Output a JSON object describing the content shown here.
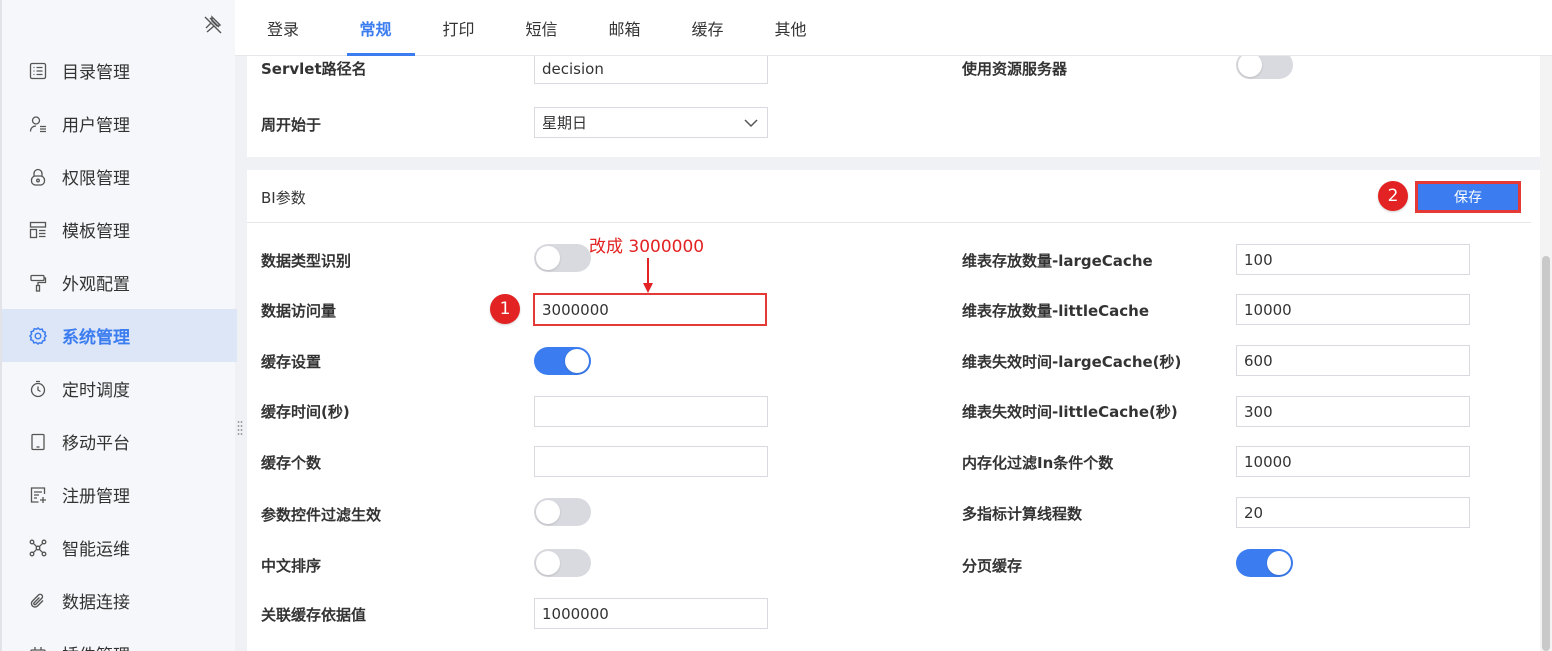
{
  "sidebar": {
    "items": [
      {
        "label": "目录管理",
        "icon": "list-icon"
      },
      {
        "label": "用户管理",
        "icon": "user-icon"
      },
      {
        "label": "权限管理",
        "icon": "lock-icon"
      },
      {
        "label": "模板管理",
        "icon": "template-icon"
      },
      {
        "label": "外观配置",
        "icon": "paint-roller-icon"
      },
      {
        "label": "系统管理",
        "icon": "gear-icon",
        "active": true
      },
      {
        "label": "定时调度",
        "icon": "timer-icon"
      },
      {
        "label": "移动平台",
        "icon": "tablet-icon"
      },
      {
        "label": "注册管理",
        "icon": "register-icon"
      },
      {
        "label": "智能运维",
        "icon": "network-icon"
      },
      {
        "label": "数据连接",
        "icon": "paperclip-icon"
      },
      {
        "label": "插件管理",
        "icon": "plugin-icon"
      }
    ]
  },
  "tabs": [
    {
      "label": "登录"
    },
    {
      "label": "常规",
      "active": true
    },
    {
      "label": "打印"
    },
    {
      "label": "短信"
    },
    {
      "label": "邮箱"
    },
    {
      "label": "缓存"
    },
    {
      "label": "其他"
    }
  ],
  "top_section": {
    "servlet_label": "Servlet路径名",
    "servlet_value": "decision",
    "resource_server_label": "使用资源服务器",
    "resource_server_on": false,
    "week_start_label": "周开始于",
    "week_start_value": "星期日"
  },
  "bi_section": {
    "title": "BI参数",
    "save_label": "保存",
    "left": [
      {
        "label": "数据类型识别",
        "type": "toggle",
        "on": false
      },
      {
        "label": "数据访问量",
        "type": "input",
        "value": "3000000"
      },
      {
        "label": "缓存设置",
        "type": "toggle",
        "on": true
      },
      {
        "label": "缓存时间(秒)",
        "type": "input",
        "value": ""
      },
      {
        "label": "缓存个数",
        "type": "input",
        "value": ""
      },
      {
        "label": "参数控件过滤生效",
        "type": "toggle",
        "on": false
      },
      {
        "label": "中文排序",
        "type": "toggle",
        "on": false
      },
      {
        "label": "关联缓存依据值",
        "type": "input",
        "value": "1000000"
      }
    ],
    "right": [
      {
        "label": "维表存放数量-largeCache",
        "type": "input",
        "value": "100"
      },
      {
        "label": "维表存放数量-littleCache",
        "type": "input",
        "value": "10000"
      },
      {
        "label": "维表失效时间-largeCache(秒)",
        "type": "input",
        "value": "600"
      },
      {
        "label": "维表失效时间-littleCache(秒)",
        "type": "input",
        "value": "300"
      },
      {
        "label": "内存化过滤In条件个数",
        "type": "input",
        "value": "10000"
      },
      {
        "label": "多指标计算线程数",
        "type": "input",
        "value": "20"
      },
      {
        "label": "分页缓存",
        "type": "toggle",
        "on": true
      }
    ]
  },
  "annotations": {
    "step1": "1",
    "step2": "2",
    "note": "改成 3000000"
  },
  "colors": {
    "accent": "#3b7df0",
    "annotation_red": "#e32323",
    "toggle_off": "#d9dadf"
  }
}
